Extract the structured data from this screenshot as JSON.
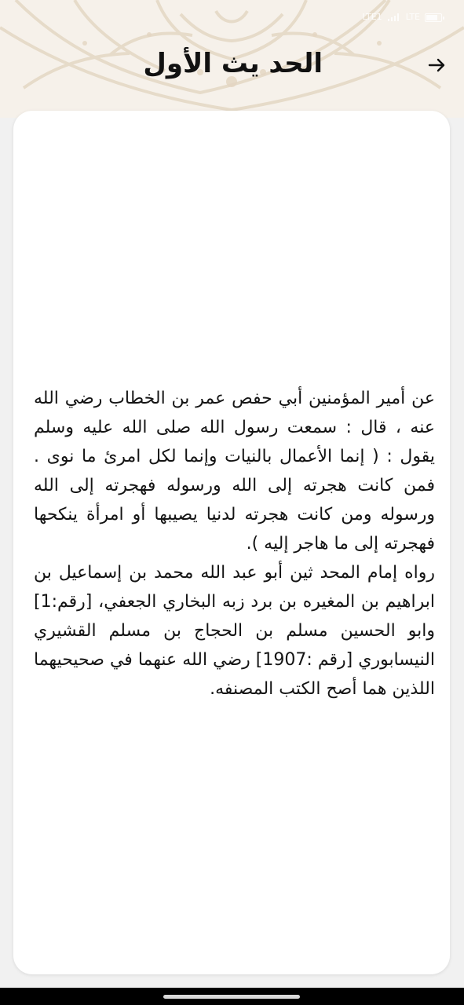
{
  "header": {
    "title": "الحد يث الأول",
    "back_icon": "arrow-right-icon"
  },
  "status_bar": {
    "items": [
      "LTE1",
      "LTE"
    ],
    "signal_icon": "signal-icon",
    "battery_icon": "battery-icon"
  },
  "content": {
    "paragraphs": [
      "عن أمير المؤمنين أبي حفص عمر بن الخطاب رضي الله عنه ، قال : سمعت رسول الله صلى الله عليه وسلم يقول : ( إنما الأعمال بالنيات وإنما لكل امرئ ما نوى . فمن كانت هجرته إلى الله ورسوله فهجرته إلى الله ورسوله ومن كانت هجرته لدنيا يصيبها أو امرأة ينكحها فهجرته إلى ما هاجر إليه ).",
      "رواه إمام المحد ثين أبو عبد الله محمد بن إسماعيل بن ابراهيم بن المغيره بن برد زبه البخاري الجعفي، [رقم:1] وابو الحسين مسلم بن الحجاج بن مسلم القشيري النيسابوري [رقم :1907] رضي الله عنهما في صحيحيهما اللذين هما أصح الكتب المصنفه."
    ]
  },
  "colors": {
    "background": "#f1f1f1",
    "card": "#ffffff",
    "ornament": "#e8dccb",
    "text": "#141414",
    "title": "#111111"
  }
}
